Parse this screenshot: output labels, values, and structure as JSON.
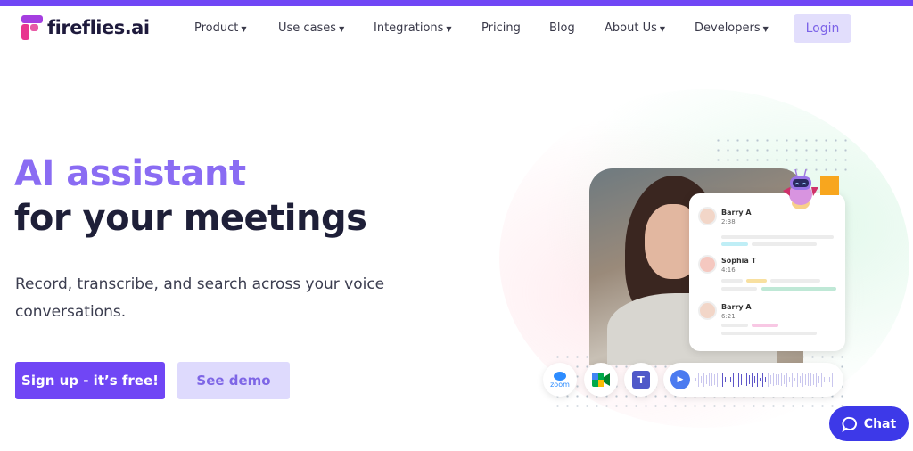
{
  "brand": {
    "name": "fireflies.ai",
    "accent": "#7046f5"
  },
  "nav": {
    "items": [
      {
        "label": "Product",
        "dropdown": true
      },
      {
        "label": "Use cases",
        "dropdown": true
      },
      {
        "label": "Integrations",
        "dropdown": true
      },
      {
        "label": "Pricing",
        "dropdown": false
      },
      {
        "label": "Blog",
        "dropdown": false
      },
      {
        "label": "About Us",
        "dropdown": true
      },
      {
        "label": "Developers",
        "dropdown": true
      }
    ],
    "login": "Login"
  },
  "hero": {
    "title_line1": "AI assistant",
    "title_line2": "for your meetings",
    "subtitle": "Record, transcribe, and search across your voice conversations.",
    "cta_primary": "Sign up - it’s free!",
    "cta_secondary": "See demo"
  },
  "transcript": [
    {
      "name": "Barry A",
      "time": "2:38"
    },
    {
      "name": "Sophia T",
      "time": "4:16"
    },
    {
      "name": "Barry A",
      "time": "6:21"
    }
  ],
  "integrations": {
    "zoom": "zoom",
    "icons": [
      "zoom-icon",
      "google-meet-icon",
      "microsoft-teams-icon"
    ]
  },
  "chat": {
    "label": "Chat"
  }
}
